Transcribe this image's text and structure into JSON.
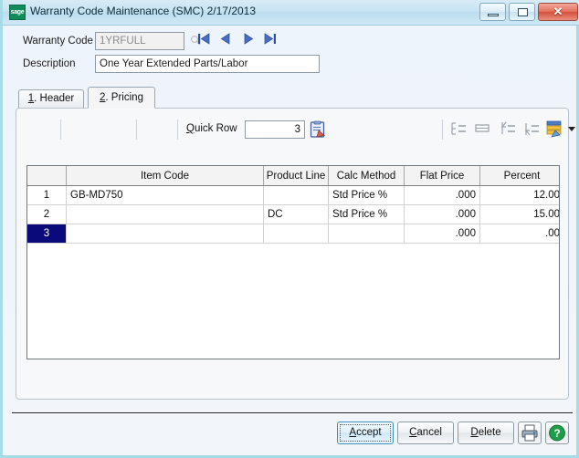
{
  "window": {
    "title": "Warranty Code Maintenance (SMC) 2/17/2013",
    "logo_text": "sage",
    "controls": {
      "minimize": "minimize-button",
      "maximize": "maximize-button",
      "close_glyph": "✕"
    }
  },
  "header": {
    "warranty_code_label": "Warranty Code",
    "warranty_code_value": "1YRFULL",
    "description_label": "Description",
    "description_value": "One Year Extended Parts/Labor",
    "nav": {
      "first": "first-record",
      "previous": "previous-record",
      "next": "next-record",
      "last": "last-record"
    }
  },
  "tabs": [
    {
      "label": "1. Header",
      "mnemonic": "1",
      "rest": ". Header",
      "active": false
    },
    {
      "label": "2. Pricing",
      "mnemonic": "2",
      "rest": ". Pricing",
      "active": true
    }
  ],
  "toolbar": {
    "quick_row_label": "Quick Row",
    "quick_row_mnemonic": "Q",
    "quick_row_rest": "uick Row",
    "quick_row_value": "3"
  },
  "grid": {
    "columns": [
      "",
      "Item Code",
      "Product Line",
      "Calc Method",
      "Flat Price",
      "Percent"
    ],
    "rows": [
      {
        "num": "1",
        "item_code": "GB-MD750",
        "product_line": "",
        "calc_method": "Std Price %",
        "flat_price": ".000",
        "percent": "12.00",
        "selected": false,
        "percent_highlight": false
      },
      {
        "num": "2",
        "item_code": "",
        "product_line": "DC",
        "calc_method": "Std Price %",
        "flat_price": ".000",
        "percent": "15.00",
        "selected": false,
        "percent_highlight": false
      },
      {
        "num": "3",
        "item_code": "",
        "product_line": "",
        "calc_method": "",
        "flat_price": ".000",
        "percent": ".00",
        "selected": true,
        "percent_highlight": true
      }
    ]
  },
  "buttons": {
    "accept": "Accept",
    "accept_mnemonic": "A",
    "accept_rest": "ccept",
    "cancel": "Cancel",
    "cancel_mnemonic": "C",
    "cancel_rest": "ancel",
    "delete": "Delete",
    "delete_mnemonic": "D",
    "delete_rest": "elete",
    "print": "print-button",
    "help": "help-button"
  },
  "colors": {
    "window_border": "#a7dbe8",
    "title_bar": "#c8e3f2",
    "selected_row": "#0a0a7a",
    "row_number": "#d23b2e",
    "cell_highlight": "#d9dcf5",
    "sage_green": "#128a5a",
    "help_green": "#1f9e4a"
  }
}
